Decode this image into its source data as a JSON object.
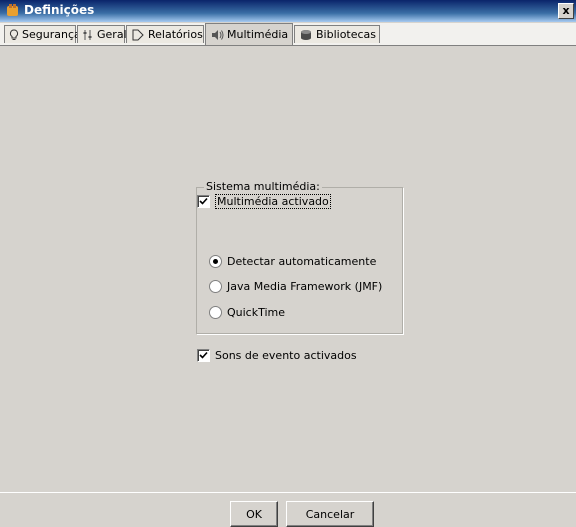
{
  "window": {
    "title": "Definições",
    "close_label": "x"
  },
  "tabs": [
    {
      "label": "Segurança",
      "icon": "lightbulb-icon",
      "active": false
    },
    {
      "label": "Geral",
      "icon": "sliders-icon",
      "active": false
    },
    {
      "label": "Relatórios",
      "icon": "report-arrow-icon",
      "active": false
    },
    {
      "label": "Multimédia",
      "icon": "speaker-icon",
      "active": true
    },
    {
      "label": "Bibliotecas",
      "icon": "database-icon",
      "active": false
    }
  ],
  "multimedia": {
    "enabled_label": "Multimédia activado",
    "enabled_checked": true,
    "group_title": "Sistema multimédia:",
    "options": [
      {
        "label": "Detectar automaticamente",
        "selected": true
      },
      {
        "label": "Java Media Framework (JMF)",
        "selected": false
      },
      {
        "label": "QuickTime",
        "selected": false
      }
    ],
    "event_sounds_label": "Sons de evento activados",
    "event_sounds_checked": true
  },
  "buttons": {
    "ok": "OK",
    "cancel": "Cancelar"
  }
}
